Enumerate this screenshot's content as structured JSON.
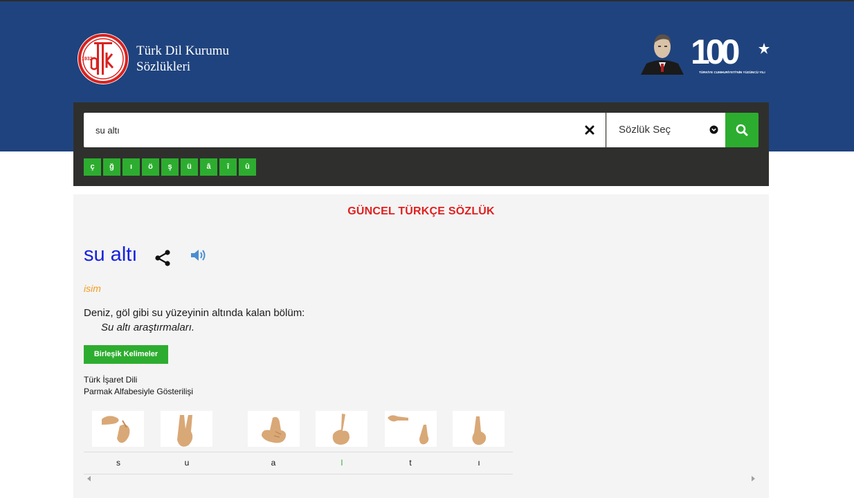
{
  "header": {
    "logo_year": "1932",
    "brand_line1": "Türk Dil Kurumu",
    "brand_line2": "Sözlükleri",
    "anniversary_number": "100",
    "anniversary_caption": "TÜRKİYE CUMHURİYETİ'NİN YÜZÜNCÜ YILI"
  },
  "search": {
    "value": "su altı",
    "select_label": "Sözlük Seç",
    "special_chars": [
      "ç",
      "ğ",
      "ı",
      "ö",
      "ş",
      "ü",
      "â",
      "î",
      "û"
    ]
  },
  "content": {
    "dictionary_title": "GÜNCEL TÜRKÇE SÖZLÜK",
    "word": "su altı",
    "part_of_speech": "isim",
    "meaning": "Deniz, göl gibi su yüzeyinin altında kalan bölüm:",
    "example": "Su altı araştırmaları.",
    "compound_button": "Birleşik Kelimeler",
    "sign_label_line1": "Türk İşaret Dili",
    "sign_label_line2": "Parmak Alfabesiyle Gösterilişi",
    "sign_letters": [
      "s",
      "u",
      "a",
      "l",
      "t",
      "ı"
    ]
  },
  "colors": {
    "header_bg": "#1f437e",
    "panel_bg": "#2f302d",
    "accent_green": "#2dad2f",
    "title_red": "#e0201f",
    "word_blue": "#1520e0",
    "pos_orange": "#f49b20"
  }
}
